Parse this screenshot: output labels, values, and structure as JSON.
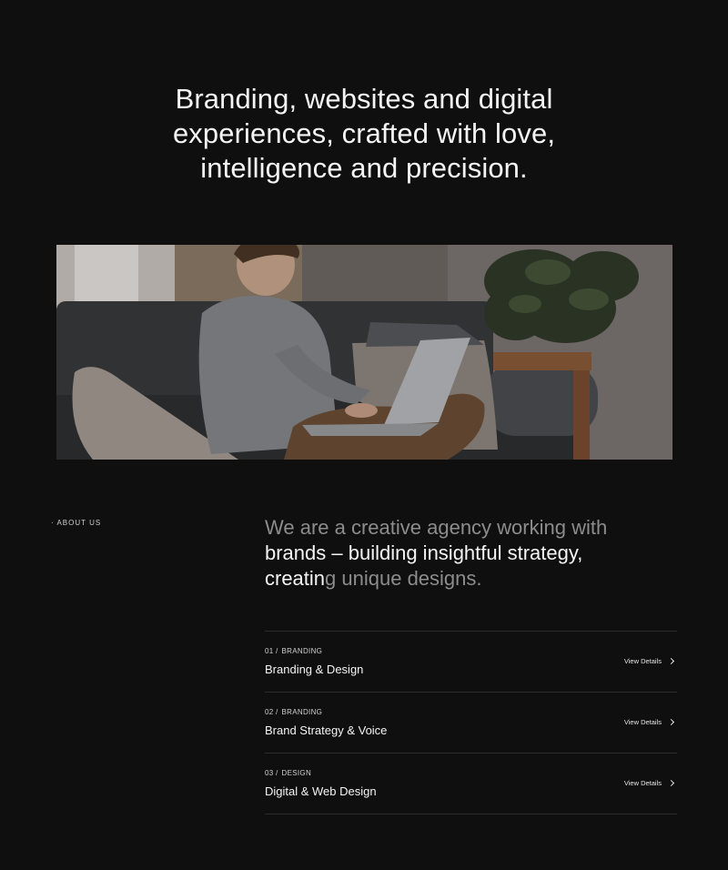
{
  "hero": {
    "title_lines": [
      "Branding, websites and digital",
      "experiences, crafted with love,",
      "intelligence and precision."
    ]
  },
  "about": {
    "label": "· ABOUT US",
    "intro_dim_1": "We are a creative agency working with",
    "intro_bright_1": "brands – building insightful strategy,",
    "intro_bright_2": "creatin",
    "intro_dim_2": "g unique designs."
  },
  "services": [
    {
      "number": "01 /",
      "category": "BRANDING",
      "name": "Branding & Design",
      "link": "View Details"
    },
    {
      "number": "02 /",
      "category": "BRANDING",
      "name": "Brand Strategy & Voice",
      "link": "View Details"
    },
    {
      "number": "03 /",
      "category": "DESIGN",
      "name": "Digital & Web Design",
      "link": "View Details"
    }
  ],
  "colors": {
    "background": "#0f0f0f",
    "text": "#f2f2f2",
    "muted": "#8c8c8c"
  }
}
